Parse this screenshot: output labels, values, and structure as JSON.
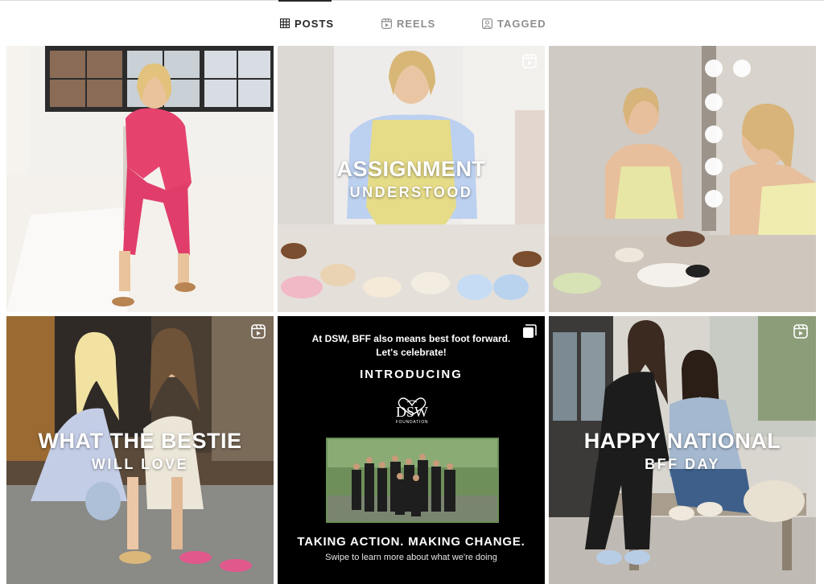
{
  "tabs": [
    {
      "label": "POSTS",
      "icon": "grid-icon",
      "active": true
    },
    {
      "label": "REELS",
      "icon": "reels-icon",
      "active": false
    },
    {
      "label": "TAGGED",
      "icon": "tagged-icon",
      "active": false
    }
  ],
  "posts": [
    {
      "type": "image"
    },
    {
      "type": "reel",
      "overlay_title": "ASSIGNMENT",
      "overlay_subtitle": "UNDERSTOOD"
    },
    {
      "type": "image"
    },
    {
      "type": "reel",
      "overlay_title": "WHAT THE BESTIE",
      "overlay_subtitle": "WILL LOVE"
    },
    {
      "type": "carousel",
      "top_text_line1": "At DSW, BFF also means best foot forward.",
      "top_text_line2": "Let's celebrate!",
      "introducing": "INTRODUCING",
      "logo_text": "DSW",
      "logo_subtext": "FOUNDATION",
      "action_text": "TAKING ACTION. MAKING CHANGE.",
      "swipe_text": "Swipe to learn more about what we're doing"
    },
    {
      "type": "reel",
      "overlay_title": "HAPPY NATIONAL",
      "overlay_subtitle": "BFF DAY"
    }
  ],
  "colors": {
    "active_tab": "#262626",
    "inactive_tab": "#8e8e8e",
    "divider": "#dbdbdb"
  }
}
